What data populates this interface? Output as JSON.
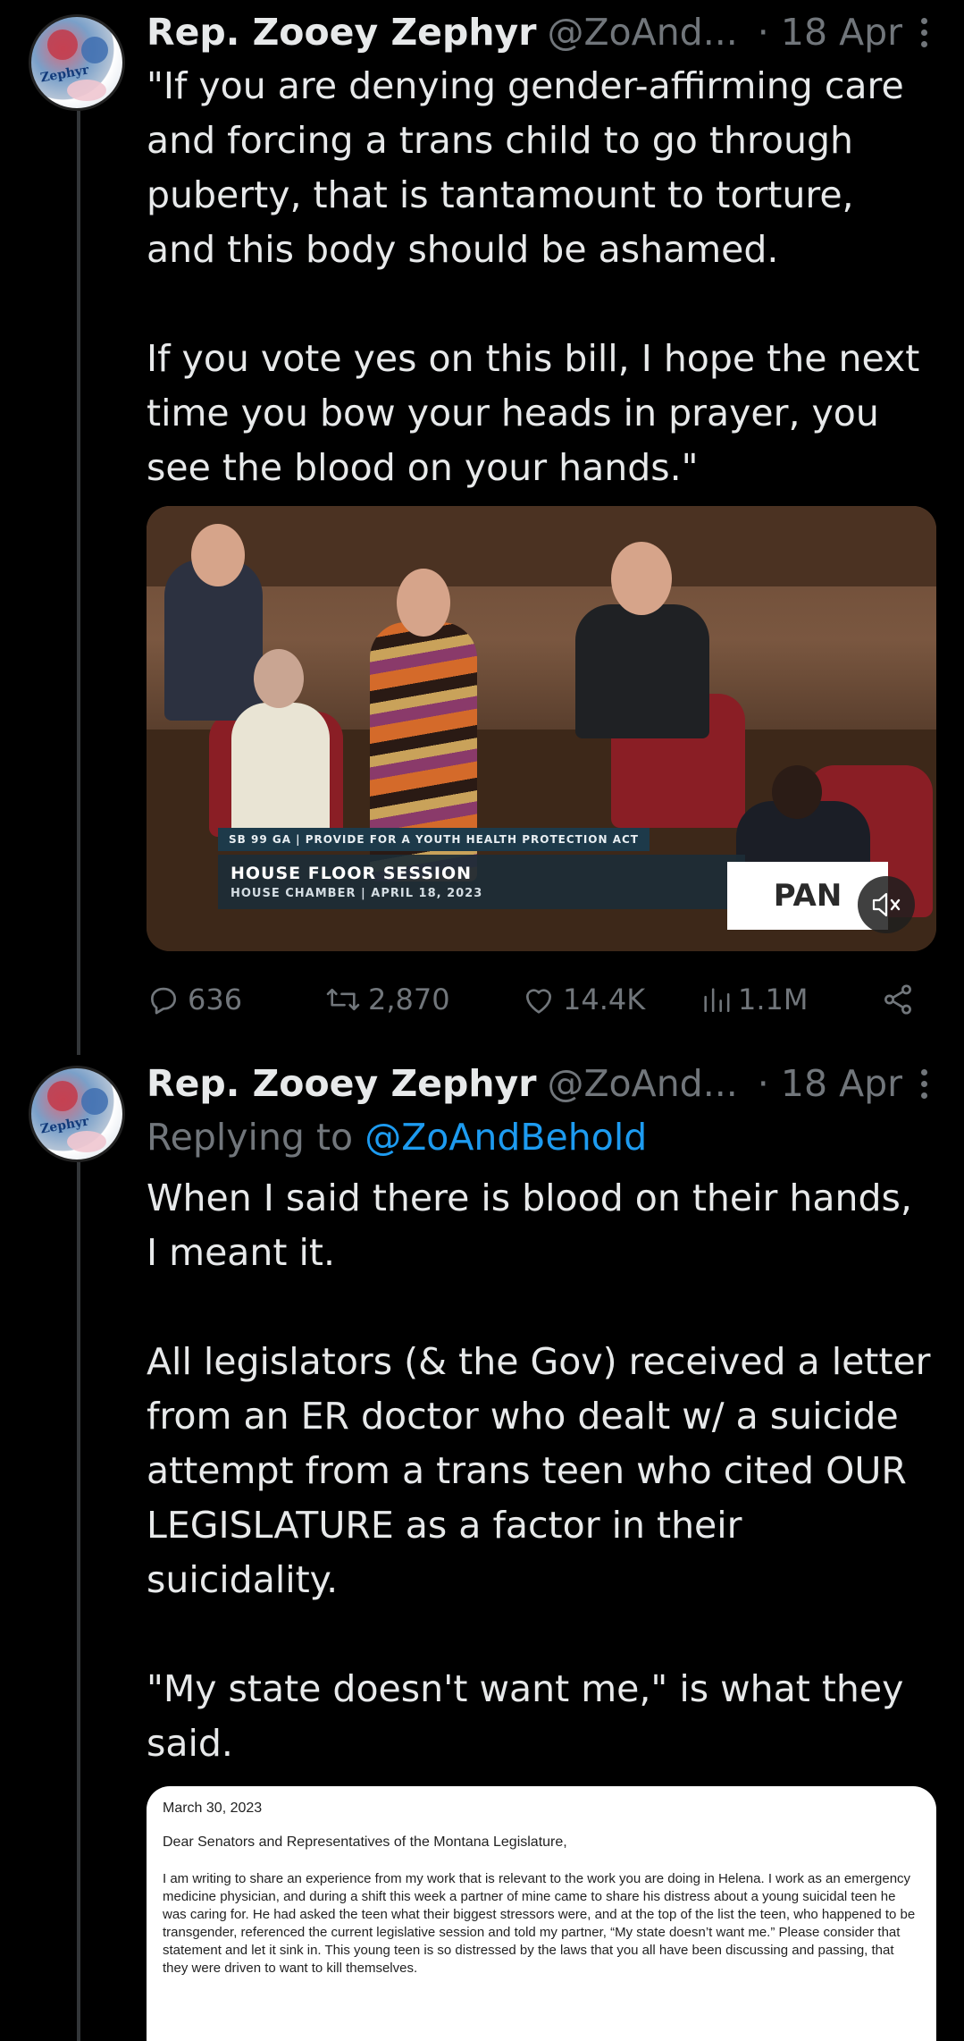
{
  "tweets": [
    {
      "author_name": "Rep. Zooey Zephyr",
      "handle": "@ZoAnd...",
      "time": "· 18 Apr",
      "avatar_text": "Zephyr",
      "text": "\"If you are denying gender-affirming care and forcing a trans child to go through puberty, that is tantamount to torture, and this body should be ashamed.\n\nIf you vote yes on this bill, I hope the next time you bow your heads in prayer, you see the blood on your hands.\"",
      "media": {
        "chyron_top": "SB 99 GA | PROVIDE FOR A YOUTH HEALTH PROTECTION ACT",
        "chyron_title": "HOUSE FLOOR SESSION",
        "chyron_sub": "HOUSE CHAMBER | APRIL 18, 2023",
        "logo_text": "PAN"
      },
      "stats": {
        "replies": "636",
        "reposts": "2,870",
        "likes": "14.4K",
        "views": "1.1M"
      }
    },
    {
      "author_name": "Rep. Zooey Zephyr",
      "handle": "@ZoAnd...",
      "time": "· 18 Apr",
      "avatar_text": "Zephyr",
      "replying_label": "Replying to",
      "replying_handle": "@ZoAndBehold",
      "text": "When I said there is blood on their hands, I meant it.\n\nAll legislators (& the Gov) received a letter from an ER doctor who dealt w/ a suicide attempt from a trans teen who cited OUR LEGISLATURE as a factor in their suicidality.\n\n\"My state doesn't want me,\" is what they said.",
      "letter": {
        "date": "March 30, 2023",
        "salutation": "Dear Senators and Representatives of the Montana Legislature,",
        "body": "I am writing to share an experience from my work that is relevant to the work you are doing in Helena.  I work as an emergency medicine physician, and during a shift this week a partner of mine came to share his distress about a young suicidal teen he was caring for.  He had asked the teen what their biggest stressors were, and at the top of the list the teen, who happened to be transgender, referenced the current legislative session and told my partner, “My state doesn’t want me.”  Please consider that statement and let it sink in.  This young teen is so distressed by the laws that you all have been discussing and passing, that they were driven to want to kill themselves."
      }
    }
  ],
  "colors": {
    "background": "#000000",
    "text": "#e7e9ea",
    "muted": "#71767b",
    "link": "#1d9bf0"
  },
  "icons": [
    "more-vertical-icon",
    "reply-icon",
    "repost-icon",
    "like-icon",
    "views-icon",
    "share-icon",
    "mute-icon"
  ]
}
